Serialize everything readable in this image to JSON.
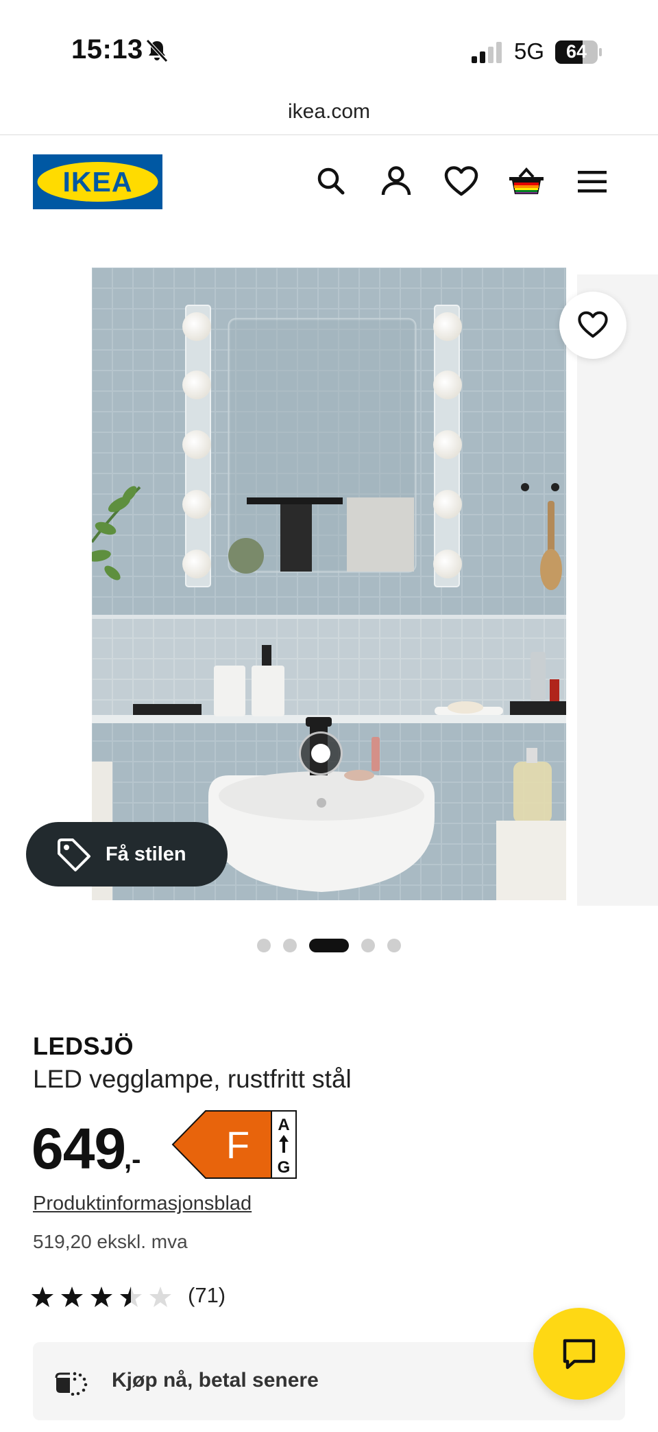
{
  "status_bar": {
    "time": "15:13",
    "network": "5G",
    "battery": "64"
  },
  "browser": {
    "url": "ikea.com"
  },
  "header": {
    "logo_text": "IKEA",
    "icons": [
      "search-icon",
      "account-icon",
      "heart-icon",
      "basket-icon",
      "menu-icon"
    ]
  },
  "gallery": {
    "style_button_label": "Få stilen",
    "slide_count": 5,
    "active_slide": 3
  },
  "product": {
    "name": "LEDSJÖ",
    "description": "LED vegglampe, rustfritt stål",
    "price": "649",
    "price_suffix": ",-",
    "energy_class": "F",
    "energy_scale_top": "A",
    "energy_scale_bottom": "G",
    "info_link": "Produktinformasjonsblad",
    "price_ex_vat": "519,20 ekskl. mva",
    "rating": 3.5,
    "rating_max": 5,
    "review_count": "(71)"
  },
  "payment": {
    "label": "Kjøp nå, betal senere"
  },
  "colors": {
    "ikea_blue": "#0058a3",
    "ikea_yellow": "#ffdb00",
    "energy_orange": "#e8640c",
    "chat_yellow": "#fed814"
  }
}
